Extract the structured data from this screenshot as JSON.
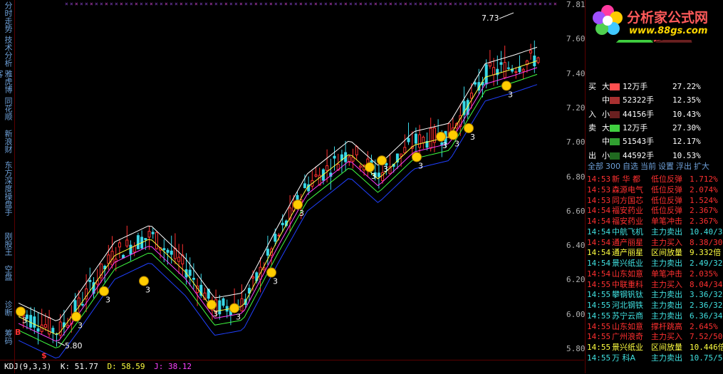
{
  "left_nav": [
    {
      "label": "分时走势"
    },
    {
      "label": "技术分析"
    },
    {
      "label": "雅虎博客"
    },
    {
      "label": "同花顺"
    },
    {
      "label": "新浪财"
    },
    {
      "label": "东方深度"
    },
    {
      "label": "操盘手"
    },
    {
      "label": "刚股王"
    },
    {
      "label": "空盘"
    },
    {
      "label": "诊断"
    },
    {
      "label": "筹码"
    }
  ],
  "price_axis": [
    "7.81",
    "7.60",
    "7.40",
    "7.20",
    "7.00",
    "6.80",
    "6.60",
    "6.40",
    "6.20",
    "6.00",
    "5.80"
  ],
  "chart": {
    "high_label": "7.73",
    "low_label": "5.80",
    "signal_number": "3",
    "buy_marker": "B",
    "sell_marker": "$",
    "colors": {
      "up": "#ff3030",
      "down": "#38d8e8",
      "ma1": "#ffffff",
      "ma2": "#ffff40",
      "ma3": "#ff40ff",
      "ma4": "#40ff40",
      "ma5": "#2040ff"
    }
  },
  "indicator": {
    "name": "KDJ(9,3,3)",
    "k": "K: 51.77",
    "d": "D: 58.59",
    "j": "J: 38.12"
  },
  "logo": {
    "title": "分析家公式网",
    "url": "www.88gs.com"
  },
  "order_flow": [
    {
      "side": "买",
      "size": "大",
      "vol": "12万手",
      "pct": "27.22%",
      "color": "#ff5050"
    },
    {
      "side": "",
      "size": "中",
      "vol": "52322手",
      "pct": "12.35%",
      "color": "#a83030"
    },
    {
      "side": "入",
      "size": "小",
      "vol": "44156手",
      "pct": "10.43%",
      "color": "#6a2020"
    },
    {
      "side": "卖",
      "size": "大",
      "vol": "12万手",
      "pct": "27.30%",
      "color": "#40d040"
    },
    {
      "side": "",
      "size": "中",
      "vol": "51543手",
      "pct": "12.17%",
      "color": "#30a030"
    },
    {
      "side": "出",
      "size": "小",
      "vol": "44592手",
      "pct": "10.53%",
      "color": "#206a20"
    }
  ],
  "toolbar": [
    "全部",
    "300",
    "自选",
    "当前",
    "设置",
    "浮出",
    "扩大"
  ],
  "alerts": [
    {
      "time": "14:53",
      "name": "新 华 都",
      "event": "低位反弹",
      "value": "1.712%",
      "color": "#ff3030"
    },
    {
      "time": "14:53",
      "name": "森源电气",
      "event": "低位反弹",
      "value": "2.074%",
      "color": "#ff3030"
    },
    {
      "time": "14:53",
      "name": "同方国芯",
      "event": "低位反弹",
      "value": "1.524%",
      "color": "#ff3030"
    },
    {
      "time": "14:54",
      "name": "福安药业",
      "event": "低位反弹",
      "value": "2.367%",
      "color": "#ff3030"
    },
    {
      "time": "14:54",
      "name": "福安药业",
      "event": "单笔冲击",
      "value": "2.367%",
      "color": "#ff3030"
    },
    {
      "time": "14:54",
      "name": "中航飞机",
      "event": "主力卖出",
      "value": "10.40/3",
      "color": "#40e0e0"
    },
    {
      "time": "14:54",
      "name": "通产丽星",
      "event": "主力买入",
      "value": "8.38/30",
      "color": "#ff3030"
    },
    {
      "time": "14:54",
      "name": "通产丽星",
      "event": "区间放量",
      "value": "9.332倍",
      "color": "#ffff40"
    },
    {
      "time": "14:54",
      "name": "景兴纸业",
      "event": "主力卖出",
      "value": "2.49/32",
      "color": "#40e0e0"
    },
    {
      "time": "14:54",
      "name": "山东如意",
      "event": "单笔冲击",
      "value": "2.035%",
      "color": "#ff3030"
    },
    {
      "time": "14:55",
      "name": "中联重科",
      "event": "主力买入",
      "value": "8.04/34",
      "color": "#ff3030"
    },
    {
      "time": "14:55",
      "name": "攀钢钒钛",
      "event": "主力卖出",
      "value": "3.36/32",
      "color": "#40e0e0"
    },
    {
      "time": "14:55",
      "name": "河北钢铁",
      "event": "主力卖出",
      "value": "2.36/32",
      "color": "#40e0e0"
    },
    {
      "time": "14:55",
      "name": "苏宁云商",
      "event": "主力卖出",
      "value": "6.36/34",
      "color": "#40e0e0"
    },
    {
      "time": "14:55",
      "name": "山东如意",
      "event": "撑杆跳高",
      "value": "2.645%",
      "color": "#ff3030"
    },
    {
      "time": "14:55",
      "name": "广州浪奇",
      "event": "主力买入",
      "value": "7.52/50",
      "color": "#ff3030"
    },
    {
      "time": "14:55",
      "name": "景兴纸业",
      "event": "区间放量",
      "value": "10.446倍",
      "color": "#ffff40"
    },
    {
      "time": "14:55",
      "name": "万   科A",
      "event": "主力卖出",
      "value": "10.75/5",
      "color": "#40e0e0"
    }
  ]
}
